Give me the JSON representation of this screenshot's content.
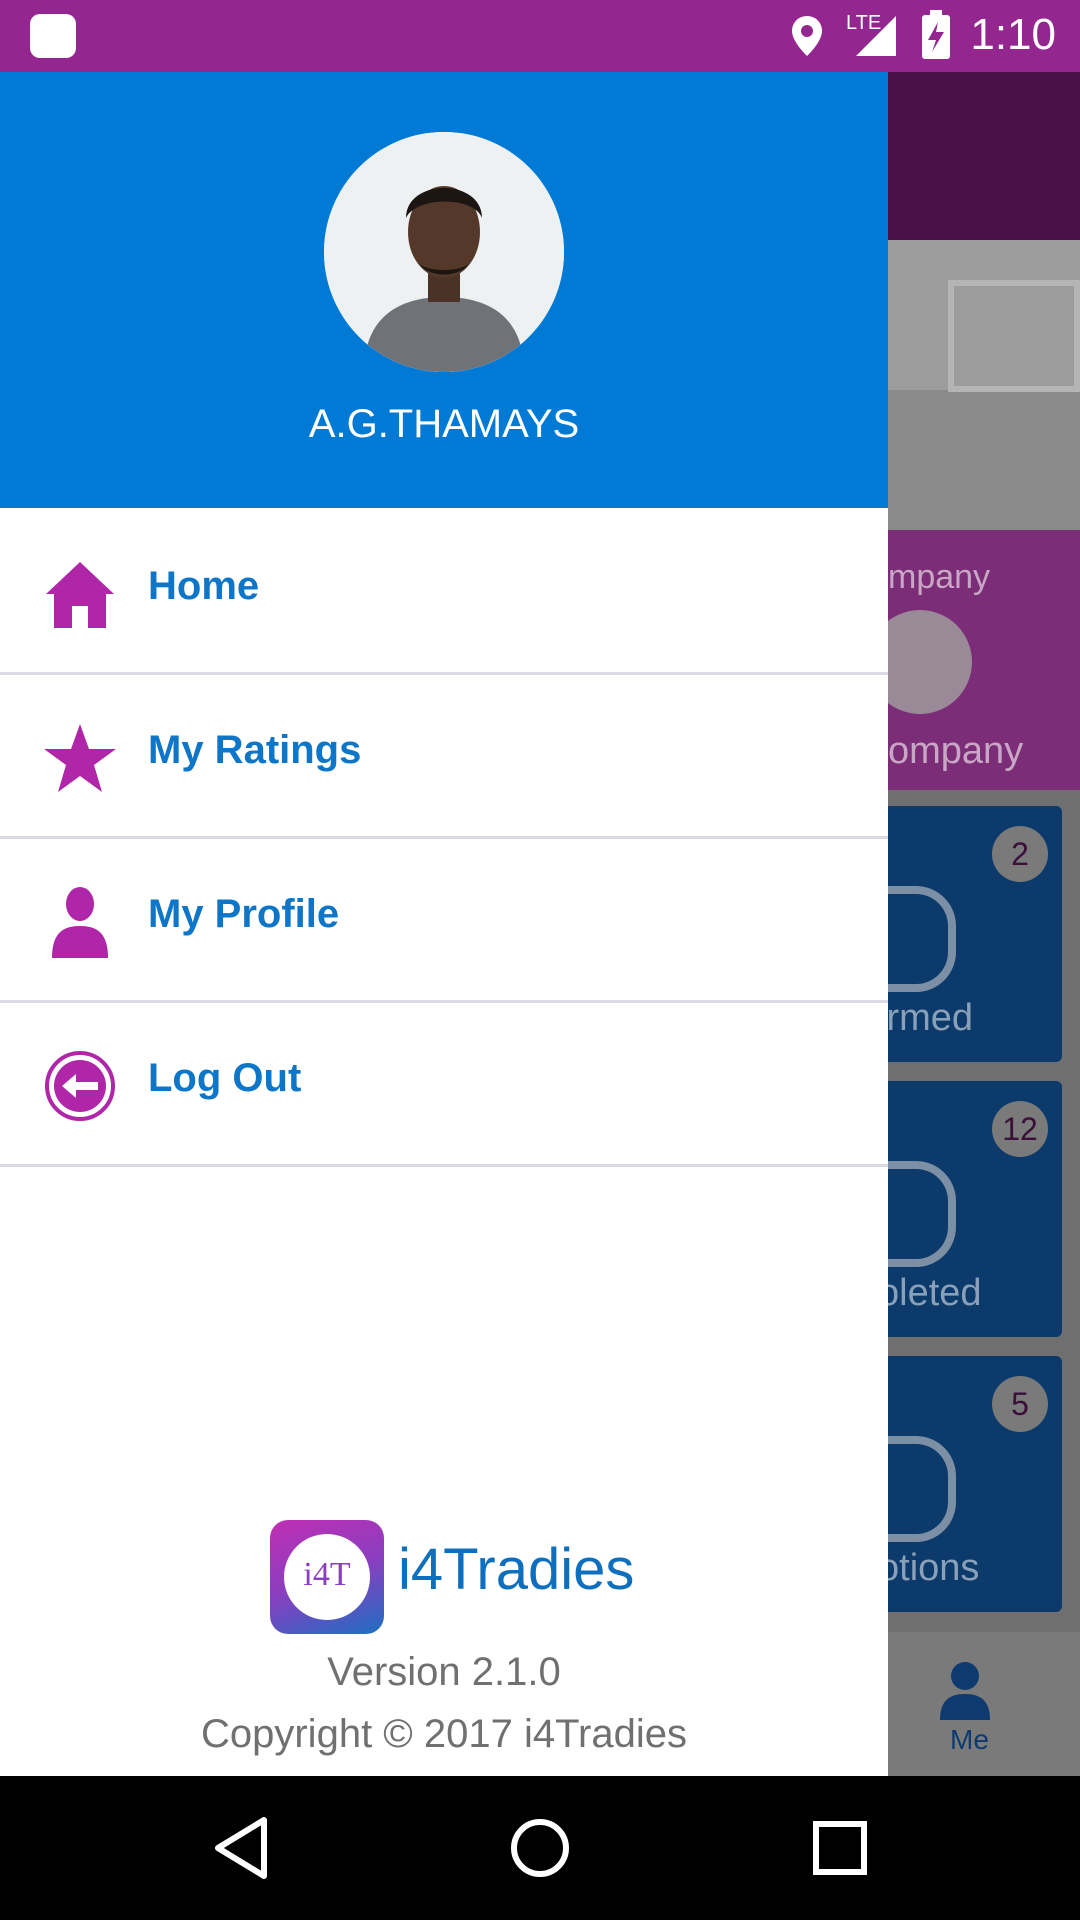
{
  "status_bar": {
    "time": "1:10",
    "network": "LTE",
    "icons": [
      "notification-icon",
      "location-icon",
      "signal-icon",
      "battery-charging-icon"
    ]
  },
  "background_screen": {
    "company_label_top": "mpany",
    "company_label_bottom": "ompany",
    "cards": [
      {
        "badge": "2",
        "label": "irmed"
      },
      {
        "badge": "12",
        "label": "oleted"
      },
      {
        "badge": "5",
        "label": "otions"
      }
    ],
    "bottom_nav_me": "Me"
  },
  "drawer": {
    "user_name": "A.G.THAMAYS",
    "menu": [
      {
        "label": "Home",
        "icon": "home-icon"
      },
      {
        "label": "My Ratings",
        "icon": "star-icon"
      },
      {
        "label": "My Profile",
        "icon": "person-icon"
      },
      {
        "label": "Log Out",
        "icon": "logout-icon"
      }
    ],
    "footer": {
      "brand": "i4Tradies",
      "logo_text": "i4T",
      "version": "Version 2.1.0",
      "copyright": "Copyright © 2017 i4Tradies"
    }
  },
  "colors": {
    "status_bar": "#94278f",
    "drawer_header": "#007ad5",
    "menu_icon": "#b026a8",
    "menu_text": "#0e76c8"
  },
  "nav_bar": {
    "icons": [
      "back-icon",
      "home-circle-icon",
      "recents-icon"
    ]
  }
}
